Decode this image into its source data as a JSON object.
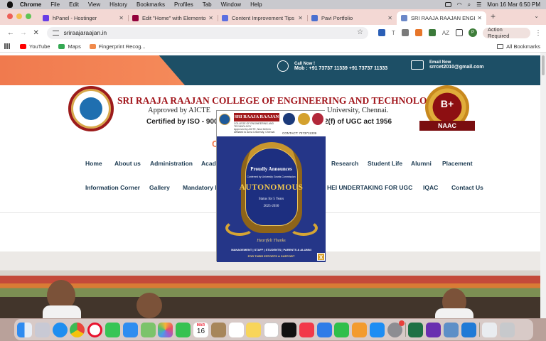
{
  "menubar": {
    "app": "Chrome",
    "items": [
      "File",
      "Edit",
      "View",
      "History",
      "Bookmarks",
      "Profiles",
      "Tab",
      "Window",
      "Help"
    ],
    "clock": "Mon 16 Mar  6:50 PM"
  },
  "tabs": [
    {
      "label": "hPanel - Hostinger",
      "color": "#673de6"
    },
    {
      "label": "Edit \"Home\" with Elementor",
      "color": "#92003b"
    },
    {
      "label": "Content Improvement Tips",
      "color": "#5b6ee1"
    },
    {
      "label": "Pavi Portfolio",
      "color": "#4a6fd0"
    },
    {
      "label": "SRI RAAJA RAAJAN ENGINE",
      "color": "#6b88c8",
      "active": true
    }
  ],
  "toolbar": {
    "url": "sriraajaraajan.in",
    "action_label": "Action Required",
    "avatar_letter": "P"
  },
  "bookmarks": [
    {
      "label": "YouTube",
      "color": "#ff0000"
    },
    {
      "label": "Maps",
      "color": "#34a853"
    },
    {
      "label": "Fingerprint Recog...",
      "color": "#f08a4b"
    }
  ],
  "all_bookmarks_label": "All Bookmarks",
  "site": {
    "call_label": "Call Now !",
    "call_numbers": "Mob : +91 73737 11339   +91 73737 11333",
    "email_label": "Email Now",
    "email": "srrcet2010@gmail.com",
    "college_name": "SRI RAAJA RAAJAN COLLEGE OF ENGINEERING AND TECHNOLOGY",
    "approved_left": "Approved by AICTE",
    "approved_right": "University, Chennai.",
    "iso_left": "Certified by ISO - 9001",
    "iso_right": "2(f) of UGC act 1956",
    "naac_grade": "B+",
    "naac_label": "NAAC",
    "partial_heading": "C",
    "nav_row1": [
      "Home",
      "About us",
      "Administration",
      "Acad",
      "Research",
      "Student Life",
      "Alumni",
      "Placement"
    ],
    "nav_row2": [
      "Information Corner",
      "Gallery",
      "Mandatory D",
      "HEI UNDERTAKING FOR UGC",
      "IQAC",
      "Contact Us"
    ]
  },
  "popup": {
    "college": "SRI RAAJA RAAJAN",
    "college_sub": "COLLEGE OF ENGINEERING AND TECHNOLOGY",
    "approval_line": "Approved by AICTE, New Delhi & Affiliated to Anna University, Chennai",
    "contact": "CONTACT: 7373711339",
    "announces": "Proudly Announces",
    "conferred": "Conferred by University Grants Commission",
    "autonomous": "AUTONOMOUS",
    "status": "Status for 5 Years",
    "years": "2025-2030",
    "heartfelt": "Heartfelt Thanks",
    "to_line": "MANAGEMENT | STAFF | STUDENTS | PARENTS & ALUMNI",
    "effort_line": "FOR THEIR EFFORTS & SUPPORT",
    "close": "X"
  },
  "dock": {
    "calendar_month": "MAR",
    "calendar_day": "16",
    "apps": [
      "finder",
      "launchpad",
      "safari",
      "chrome",
      "opera",
      "messages",
      "mail",
      "maps",
      "photos",
      "facetime",
      "calendar",
      "notes-brown",
      "reminders",
      "notes",
      "freeform",
      "appletv",
      "music",
      "keynote",
      "numbers",
      "pages",
      "appstore",
      "settings",
      "excel",
      "affinity",
      "preview",
      "vscode",
      "downloads",
      "trash"
    ]
  }
}
